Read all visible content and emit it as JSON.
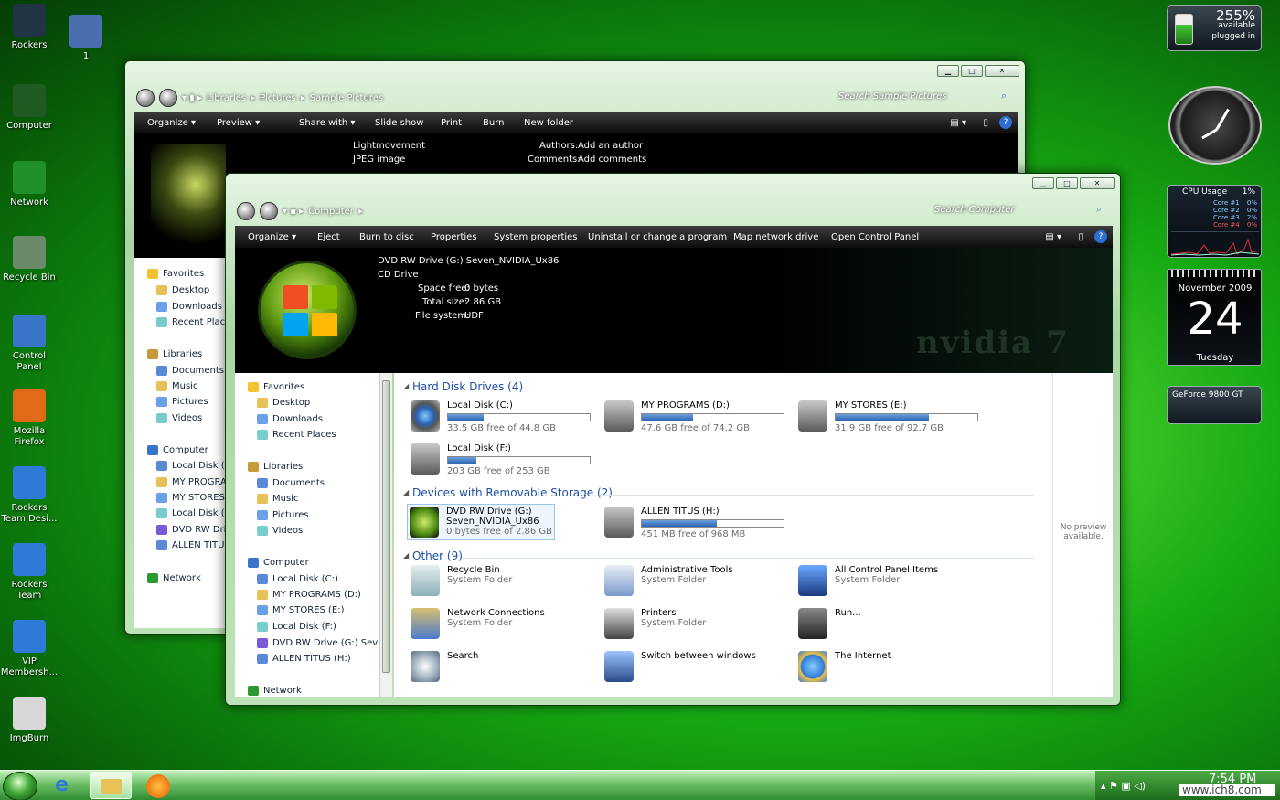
{
  "desktop": {
    "icons": [
      {
        "label": "Rockers",
        "color": "#234"
      },
      {
        "label": "1",
        "color": "#4a6fb0"
      },
      {
        "label": "Computer",
        "color": "#1f5a22"
      },
      {
        "label": "Network",
        "color": "#21902a"
      },
      {
        "label": "Recycle Bin",
        "color": "#6a8a6a"
      },
      {
        "label": "Control Panel",
        "color": "#3874c8"
      },
      {
        "label": "Mozilla Firefox",
        "color": "#e06a18"
      },
      {
        "label": "Rockers Team Desi...",
        "color": "#2e7ad6"
      },
      {
        "label": "Rockers Team",
        "color": "#2e7ad6"
      },
      {
        "label": "VIP Membersh...",
        "color": "#2e7ad6"
      },
      {
        "label": "ImgBurn",
        "color": "#d8d8d8"
      }
    ]
  },
  "win_back": {
    "breadcrumb": [
      "Libraries",
      "Pictures",
      "Sample Pictures"
    ],
    "search_placeholder": "Search Sample Pictures",
    "toolbar": [
      "Organize ▾",
      "Preview ▾",
      "Share with ▾",
      "Slide show",
      "Print",
      "Burn",
      "New folder"
    ],
    "details": {
      "name": "Lightmovement",
      "type": "JPEG image",
      "authors_label": "Authors:",
      "authors_value": "Add an author",
      "comments_label": "Comments:",
      "comments_value": "Add comments"
    },
    "nav": [
      "Favorites",
      "Desktop",
      "Downloads",
      "Recent Places",
      "Libraries",
      "Documents",
      "Music",
      "Pictures",
      "Videos",
      "Computer",
      "Local Disk (C:",
      "MY PROGRAM",
      "MY STORES (",
      "Local Disk (F:",
      "DVD RW Driv",
      "ALLEN TITUS",
      "Network"
    ]
  },
  "win_front": {
    "breadcrumb": [
      "Computer"
    ],
    "search_placeholder": "Search Computer",
    "toolbar": [
      "Organize ▾",
      "Eject",
      "Burn to disc",
      "Properties",
      "System properties",
      "Uninstall or change a program",
      "Map network drive",
      "Open Control Panel"
    ],
    "details": {
      "title": "DVD RW Drive (G:) Seven_NVIDIA_Ux86",
      "subtitle": "CD Drive",
      "space_free_label": "Space free:",
      "space_free_value": "0 bytes",
      "total_size_label": "Total size:",
      "total_size_value": "2.86 GB",
      "file_system_label": "File system:",
      "file_system_value": "UDF",
      "watermark": "nvidia 7"
    },
    "nav": [
      "Favorites",
      "Desktop",
      "Downloads",
      "Recent Places",
      "Libraries",
      "Documents",
      "Music",
      "Pictures",
      "Videos",
      "Computer",
      "Local Disk (C:)",
      "MY PROGRAMS (D:)",
      "MY STORES (E:)",
      "Local Disk (F:)",
      "DVD RW Drive (G:) Seven_N",
      "ALLEN TITUS (H:)",
      "Network"
    ],
    "groups": {
      "hdd": "Hard Disk Drives (4)",
      "removable": "Devices with Removable Storage (2)",
      "other": "Other (9)"
    },
    "drives": [
      {
        "name": "Local Disk (C:)",
        "info": "33.5 GB free of 44.8 GB",
        "used": 0.25
      },
      {
        "name": "MY PROGRAMS (D:)",
        "info": "47.6 GB free of 74.2 GB",
        "used": 0.36
      },
      {
        "name": "MY STORES (E:)",
        "info": "31.9 GB free of 92.7 GB",
        "used": 0.66
      },
      {
        "name": "Local Disk (F:)",
        "info": "203 GB free of 253 GB",
        "used": 0.2
      }
    ],
    "removable": [
      {
        "name": "DVD RW Drive (G:)",
        "name2": "Seven_NVIDIA_Ux86",
        "info": "0 bytes free of 2.86 GB"
      },
      {
        "name": "ALLEN TITUS (H:)",
        "info": "451 MB free of 968 MB",
        "used": 0.53
      }
    ],
    "other": [
      {
        "name": "Recycle Bin",
        "sub": "System Folder"
      },
      {
        "name": "Administrative Tools",
        "sub": "System Folder"
      },
      {
        "name": "All Control Panel Items",
        "sub": "System Folder"
      },
      {
        "name": "Network Connections",
        "sub": "System Folder"
      },
      {
        "name": "Printers",
        "sub": "System Folder"
      },
      {
        "name": "Run...",
        "sub": ""
      },
      {
        "name": "Search",
        "sub": ""
      },
      {
        "name": "Switch between windows",
        "sub": ""
      },
      {
        "name": "The Internet",
        "sub": ""
      }
    ],
    "preview": "No preview available."
  },
  "gadgets": {
    "battery": {
      "percent": "255%",
      "available": "available",
      "status": "plugged in"
    },
    "cpu": {
      "title": "CPU Usage",
      "total": "1%",
      "cores": [
        {
          "name": "Core #1",
          "value": "0%"
        },
        {
          "name": "Core #2",
          "value": "0%"
        },
        {
          "name": "Core #3",
          "value": "2%"
        },
        {
          "name": "Core #4",
          "value": "0%"
        }
      ]
    },
    "calendar": {
      "month": "November 2009",
      "day": "24",
      "weekday": "Tuesday"
    },
    "gpu": {
      "label": "GeForce 9800 GT"
    }
  },
  "taskbar": {
    "clock": "7:54 PM",
    "watermark": "www.ich8.com"
  }
}
